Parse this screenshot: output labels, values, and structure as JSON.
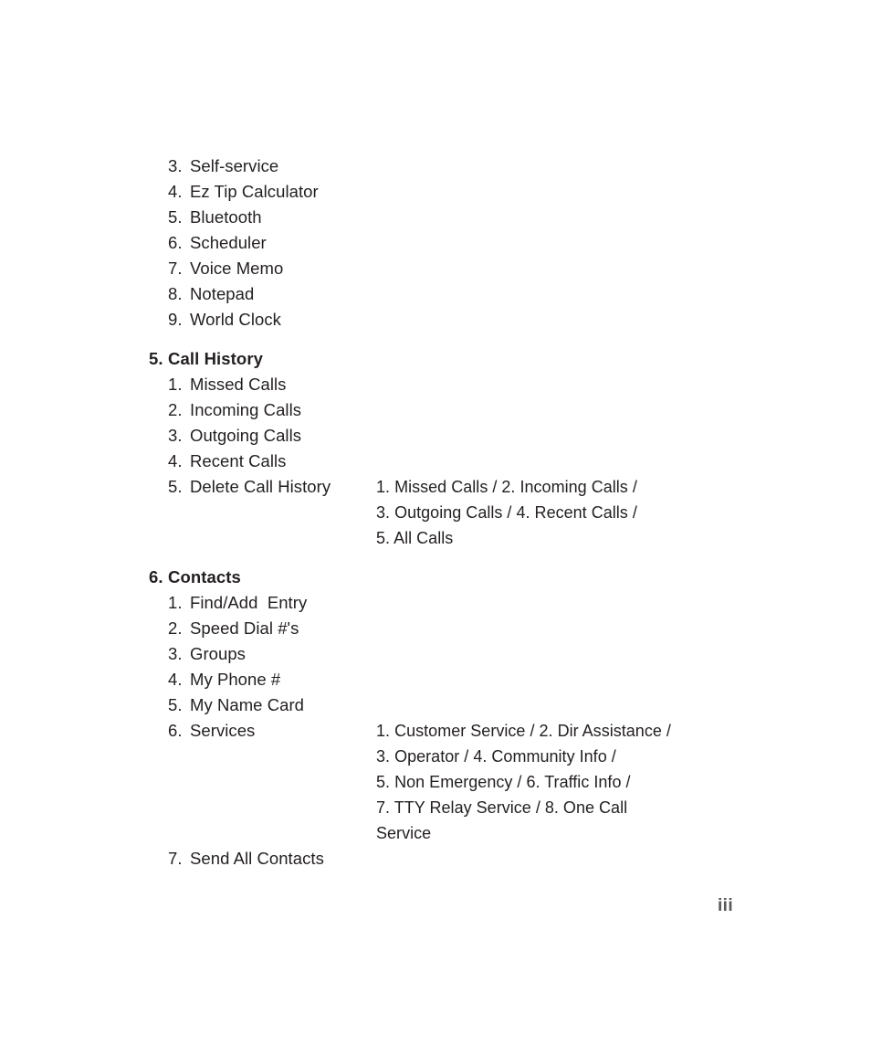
{
  "page": {
    "folio": "iii",
    "background_color": "#ffffff",
    "text_color": "#231f20",
    "folio_color": "#58595b"
  },
  "toc": {
    "blocks": [
      {
        "type": "items",
        "rows": [
          {
            "num": "3.",
            "label": "Self-service",
            "detail": ""
          },
          {
            "num": "4.",
            "label": "Ez Tip Calculator",
            "detail": ""
          },
          {
            "num": "5.",
            "label": "Bluetooth",
            "detail": ""
          },
          {
            "num": "6.",
            "label": "Scheduler",
            "detail": ""
          },
          {
            "num": "7.",
            "label": "Voice Memo",
            "detail": ""
          },
          {
            "num": "8.",
            "label": "Notepad",
            "detail": ""
          },
          {
            "num": "9.",
            "label": "World Clock",
            "detail": ""
          }
        ]
      },
      {
        "type": "section",
        "num": "5.",
        "title": "Call History",
        "rows": [
          {
            "num": "1.",
            "label": "Missed Calls",
            "detail": ""
          },
          {
            "num": "2.",
            "label": "Incoming Calls",
            "detail": ""
          },
          {
            "num": "3.",
            "label": "Outgoing Calls",
            "detail": ""
          },
          {
            "num": "4.",
            "label": "Recent Calls",
            "detail": ""
          },
          {
            "num": "5.",
            "label": "Delete Call History",
            "detail": "1. Missed Calls / 2. Incoming Calls /\n3. Outgoing Calls / 4. Recent Calls /\n5. All Calls"
          }
        ]
      },
      {
        "type": "section",
        "num": "6.",
        "title": "Contacts",
        "rows": [
          {
            "num": "1.",
            "label": "Find/Add  Entry",
            "detail": ""
          },
          {
            "num": "2.",
            "label": "Speed Dial #'s",
            "detail": ""
          },
          {
            "num": "3.",
            "label": "Groups",
            "detail": ""
          },
          {
            "num": "4.",
            "label": "My Phone #",
            "detail": ""
          },
          {
            "num": "5.",
            "label": "My Name Card",
            "detail": ""
          },
          {
            "num": "6.",
            "label": "Services",
            "detail": "1. Customer Service / 2. Dir Assistance /\n3. Operator / 4. Community Info /\n5. Non Emergency / 6. Traffic Info /\n7. TTY Relay Service / 8. One Call\nService"
          },
          {
            "num": "7.",
            "label": "Send All Contacts",
            "detail": ""
          }
        ]
      }
    ]
  }
}
